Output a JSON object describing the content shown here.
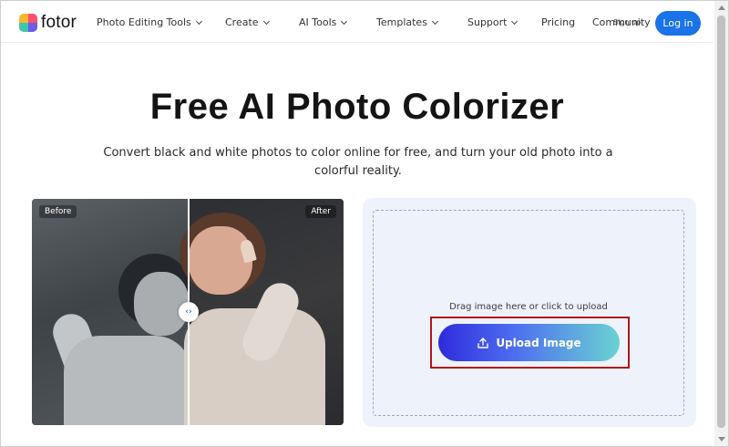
{
  "brand": {
    "name": "fotor"
  },
  "nav": {
    "items": [
      {
        "label": "Photo Editing Tools",
        "has_dropdown": true
      },
      {
        "label": "Create",
        "has_dropdown": true
      },
      {
        "label": "AI Tools",
        "has_dropdown": true
      },
      {
        "label": "Templates",
        "has_dropdown": true
      },
      {
        "label": "Support",
        "has_dropdown": true
      },
      {
        "label": "Pricing",
        "has_dropdown": false
      },
      {
        "label": "Community",
        "has_dropdown": false
      }
    ],
    "signup_label": "Sign up",
    "login_label": "Log in"
  },
  "hero": {
    "title": "Free AI Photo Colorizer",
    "subtitle": "Convert black and white photos to color online for free, and turn your old photo into a colorful reality."
  },
  "compare": {
    "before_label": "Before",
    "after_label": "After"
  },
  "upload": {
    "hint": "Drag image here or click to upload",
    "button_label": "Upload Image"
  },
  "colors": {
    "login_button": "#1a73e8",
    "upload_gradient_start": "#2f2bdc",
    "upload_gradient_end": "#6ad3d2",
    "highlight_outline": "#b3121c",
    "upload_card_bg": "#eef2fb"
  },
  "icons": {
    "upload": "upload-icon",
    "slider_handle": "compare-handle-icon"
  }
}
